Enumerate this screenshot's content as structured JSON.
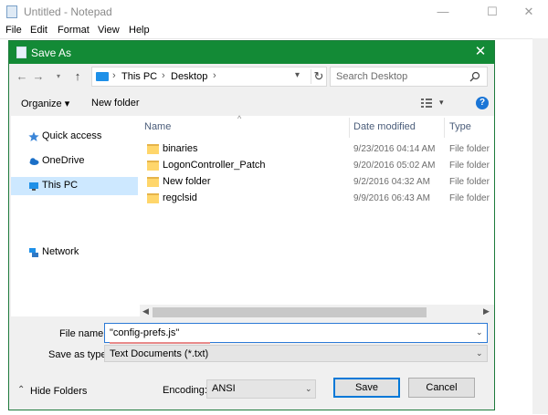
{
  "notepad": {
    "title": "Untitled - Notepad",
    "menu": [
      "File",
      "Edit",
      "Format",
      "View",
      "Help"
    ],
    "controls": {
      "minimize": "—",
      "maximize": "☐",
      "close": "✕"
    }
  },
  "dialog": {
    "title": "Save As",
    "close": "✕",
    "address": {
      "crumbs": [
        "This PC",
        "Desktop"
      ],
      "sep": "›"
    },
    "search": {
      "placeholder": "Search Desktop"
    },
    "toolbar": {
      "organize": "Organize ▾",
      "new_folder": "New folder"
    },
    "nav": [
      {
        "label": "Quick access",
        "icon": "star-icon"
      },
      {
        "label": "OneDrive",
        "icon": "cloud-icon"
      },
      {
        "label": "This PC",
        "icon": "computer-icon",
        "selected": true
      },
      {
        "label": "Network",
        "icon": "network-icon"
      }
    ],
    "columns": {
      "name": "Name",
      "date": "Date modified",
      "type": "Type"
    },
    "files": [
      {
        "name": "binaries",
        "date": "9/23/2016 04:14 AM",
        "type": "File folder"
      },
      {
        "name": "LogonController_Patch",
        "date": "9/20/2016 05:02 AM",
        "type": "File folder"
      },
      {
        "name": "New folder",
        "date": "9/2/2016 04:32 AM",
        "type": "File folder"
      },
      {
        "name": "regclsid",
        "date": "9/9/2016 06:43 AM",
        "type": "File folder"
      }
    ],
    "file_name": {
      "label": "File name:",
      "value": "\"config-prefs.js\""
    },
    "save_as_type": {
      "label": "Save as type:",
      "value": "Text Documents (*.txt)"
    },
    "hide_folders": "Hide Folders",
    "encoding": {
      "label": "Encoding:",
      "value": "ANSI"
    },
    "save": "Save",
    "cancel": "Cancel"
  }
}
